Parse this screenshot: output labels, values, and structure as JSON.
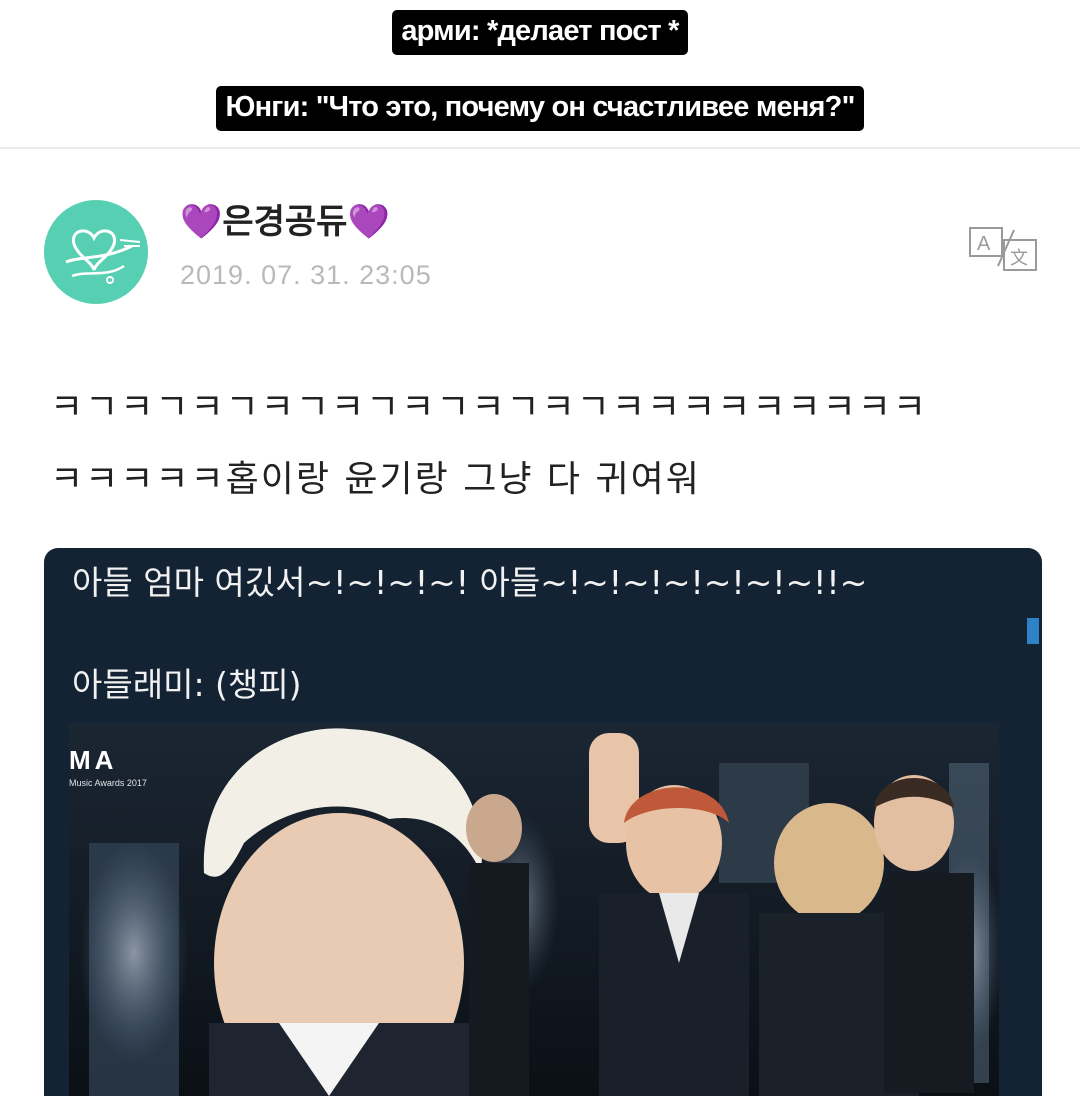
{
  "meme": {
    "caption_top": "арми: *делает пост *",
    "caption_bottom": "Юнги: \"Что это, почему он счастливее меня?\""
  },
  "post": {
    "author_heart": "💜",
    "author_name": "은경공듀",
    "date": "2019. 07. 31. 23:05",
    "translate_icon": "translate-icon",
    "body_lines": [
      "ㅋㄱㅋㄱㅋㄱㅋㄱㅋㄱㅋㄱㅋㄱㅋㄱㅋㅋㅋㅋㅋㅋㅋㅋㅋ",
      "ㅋㅋㅋㅋㅋ홉이랑 윤기랑 그냥 다 귀여워"
    ]
  },
  "embed": {
    "line1": "아들 엄마 여깄서~!~!~!~! 아들~!~!~!~!~!~!~!!~",
    "line2": "아들래미: (챙피)",
    "watermark_logo": "MA",
    "watermark_sub": "Music Awards 2017"
  },
  "colors": {
    "caption_bg": "#000000",
    "avatar": "#57cfb2",
    "heart": "#9b4dd6",
    "embed_bg": "#142334",
    "scroll_accent": "#2e82c6"
  }
}
